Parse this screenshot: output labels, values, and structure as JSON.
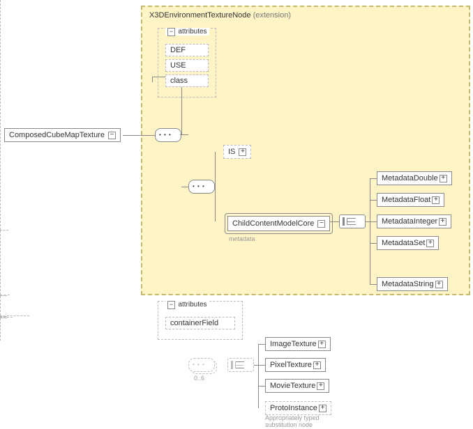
{
  "root": {
    "label": "ComposedCubeMapTexture"
  },
  "extension": {
    "title": "X3DEnvironmentTextureNode",
    "suffix": " (extension)"
  },
  "attr1": {
    "heading": "attributes",
    "items": [
      "DEF",
      "USE",
      "class"
    ]
  },
  "is_node": {
    "label": "IS"
  },
  "child_core": {
    "label": "ChildContentModelCore",
    "sublabel": "metadata"
  },
  "metadata": [
    "MetadataDouble",
    "MetadataFloat",
    "MetadataInteger",
    "MetadataSet",
    "MetadataString"
  ],
  "attr2": {
    "heading": "attributes",
    "items": [
      "containerField"
    ]
  },
  "cardinality": "0..6",
  "textures": [
    "ImageTexture",
    "PixelTexture",
    "MovieTexture",
    "ProtoInstance"
  ],
  "textures_note_l1": "Appropriately typed",
  "textures_note_l2": "substitution node"
}
